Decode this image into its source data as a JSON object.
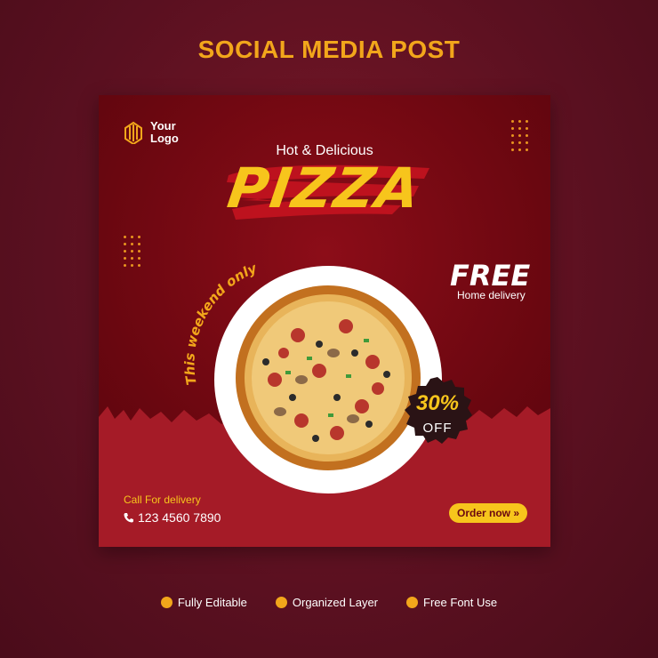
{
  "header": {
    "title": "SOCIAL MEDIA POST"
  },
  "card": {
    "logo": {
      "line1": "Your",
      "line2": "Logo"
    },
    "subtitle": "Hot & Delicious",
    "title": "PIZZA",
    "weekend_text": "This weekend only",
    "free": {
      "title": "FREE",
      "subtitle": "Home delivery"
    },
    "discount": {
      "percent": "30%",
      "label": "OFF"
    },
    "contact": {
      "label": "Call For delivery",
      "phone": "123 4560 7890"
    },
    "order_button": "Order now »"
  },
  "features": [
    {
      "label": "Fully Editable"
    },
    {
      "label": "Organized Layer"
    },
    {
      "label": "Free Font Use"
    }
  ],
  "colors": {
    "accent": "#f2a61b",
    "title_yellow": "#f7c51c",
    "card_dark": "#6a0710",
    "card_bottom": "#a51b27"
  }
}
